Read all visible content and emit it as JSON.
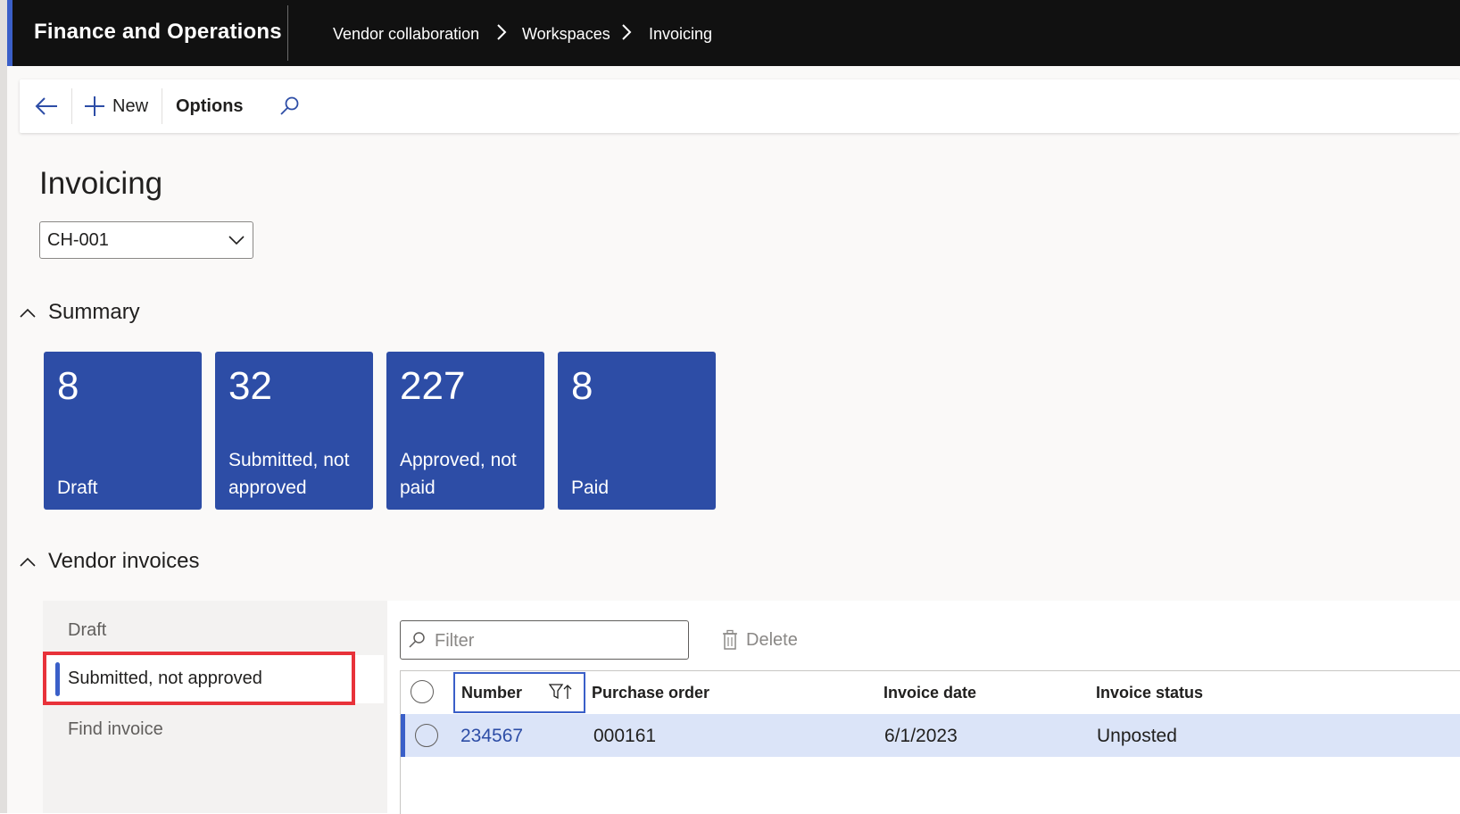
{
  "app": {
    "title": "Finance and Operations"
  },
  "breadcrumb": [
    "Vendor collaboration",
    "Workspaces",
    "Invoicing"
  ],
  "actions": {
    "new_label": "New",
    "options_label": "Options"
  },
  "page": {
    "title": "Invoicing",
    "company": "CH-001"
  },
  "summary": {
    "section_label": "Summary",
    "tiles": [
      {
        "count": "8",
        "label": "Draft"
      },
      {
        "count": "32",
        "label": "Submitted, not approved"
      },
      {
        "count": "227",
        "label": "Approved, not paid"
      },
      {
        "count": "8",
        "label": "Paid"
      }
    ]
  },
  "vendor_invoices": {
    "section_label": "Vendor invoices",
    "nav": [
      "Draft",
      "Submitted, not approved",
      "Find invoice"
    ],
    "selected_nav_index": 1,
    "filter_placeholder": "Filter",
    "delete_label": "Delete",
    "columns": [
      "Number",
      "Purchase order",
      "Invoice date",
      "Invoice status"
    ],
    "rows": [
      {
        "number": "234567",
        "purchase_order": "000161",
        "invoice_date": "6/1/2023",
        "invoice_status": "Unposted"
      }
    ]
  },
  "colors": {
    "accent": "#3a5fc8",
    "tile": "#2d4da6",
    "topbar": "#111111",
    "highlight": "#e8323a",
    "selected_row": "#dbe4f8"
  }
}
